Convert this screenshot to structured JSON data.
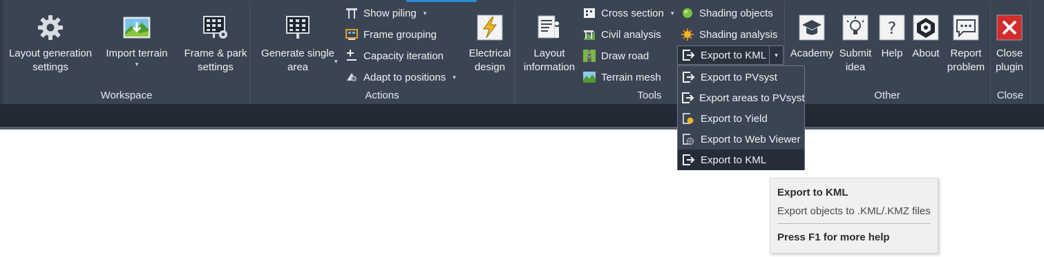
{
  "panels": {
    "workspace": "Workspace",
    "actions": "Actions",
    "tools": "Tools",
    "other": "Other",
    "close": "Close"
  },
  "workspace": {
    "layout_settings": "Layout generation\nsettings",
    "import_terrain": "Import terrain",
    "frame_park": "Frame & park\nsettings"
  },
  "actions": {
    "generate_single": "Generate single\narea",
    "show_piling": "Show piling",
    "frame_grouping": "Frame grouping",
    "capacity_iteration": "Capacity iteration",
    "adapt_positions": "Adapt to positions",
    "electrical_design": "Electrical\ndesign"
  },
  "tools": {
    "layout_information": "Layout\ninformation",
    "cross_section": "Cross section",
    "civil_analysis": "Civil analysis",
    "draw_road": "Draw road",
    "terrain_mesh": "Terrain mesh",
    "shading_objects": "Shading objects",
    "shading_analysis": "Shading analysis",
    "export_kml": "Export to KML"
  },
  "other": {
    "academy": "Academy",
    "submit_idea": "Submit\nidea",
    "help": "Help",
    "about": "About",
    "report_problem": "Report\nproblem"
  },
  "close": {
    "close_plugin": "Close\nplugin"
  },
  "export_menu": {
    "items": [
      "Export to PVsyst",
      "Export areas to PVsyst",
      "Export to Yield",
      "Export to Web Viewer",
      "Export to KML"
    ]
  },
  "tooltip": {
    "title": "Export to KML",
    "description": "Export objects to .KML/.KMZ files",
    "help": "Press F1 for more help"
  },
  "colors": {
    "ribbon_bg": "#3b4453",
    "accent": "#2a8bd6",
    "close_red": "#d42b2b"
  }
}
